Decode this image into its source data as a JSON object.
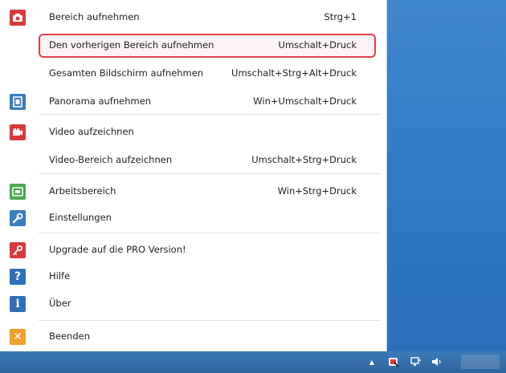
{
  "menu": {
    "items": [
      {
        "label": "Bereich aufnehmen",
        "shortcut": "Strg+1",
        "icon": "camera-icon",
        "icon_color": "#d9383c",
        "icon_glyph": "◙"
      },
      {
        "label": "Den vorherigen Bereich aufnehmen",
        "shortcut": "Umschalt+Druck"
      },
      {
        "label": "Gesamten Bildschirm aufnehmen",
        "shortcut": "Umschalt+Strg+Alt+Druck"
      },
      {
        "label": "Panorama aufnehmen",
        "shortcut": "Win+Umschalt+Druck",
        "icon": "panorama-icon",
        "icon_color": "#3a7cc0",
        "icon_glyph": "⧉"
      },
      {
        "label": "Video aufzeichnen",
        "icon": "video-camera-icon",
        "icon_color": "#d9383c",
        "icon_glyph": "■"
      },
      {
        "label": "Video-Bereich aufzeichnen",
        "shortcut": "Umschalt+Strg+Druck"
      },
      {
        "label": "Arbeitsbereich",
        "shortcut": "Win+Strg+Druck",
        "icon": "workspace-icon",
        "icon_color": "#4caa4f",
        "icon_glyph": "▣"
      },
      {
        "label": "Einstellungen",
        "icon": "wrench-icon",
        "icon_color": "#3a7cc0",
        "icon_glyph": "✎"
      },
      {
        "label": "Upgrade auf die PRO Version!",
        "icon": "key-icon",
        "icon_color": "#d9383c",
        "icon_glyph": "⚷"
      },
      {
        "label": "Hilfe",
        "icon": "help-icon",
        "icon_color": "#2f6fb8",
        "icon_glyph": "?"
      },
      {
        "label": "Über",
        "icon": "info-icon",
        "icon_color": "#2f6fb8",
        "icon_glyph": "i"
      },
      {
        "label": "Beenden",
        "icon": "close-icon",
        "icon_color": "#f0a028",
        "icon_glyph": "✕"
      }
    ]
  },
  "taskbar": {
    "tray_icons": [
      "chevron-up-icon",
      "screenshot-tool-icon",
      "network-icon",
      "volume-icon"
    ],
    "tray_glyphs": [
      "▲",
      "◆",
      "▤",
      "◀"
    ]
  },
  "colors": {
    "highlight_border": "#d9434f",
    "desktop": "#2f78c4",
    "taskbar": "#2f66a0"
  }
}
